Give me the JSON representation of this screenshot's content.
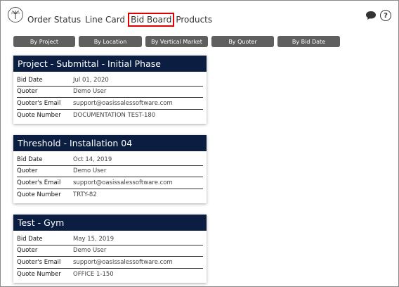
{
  "nav": {
    "items": [
      "Order Status",
      "Line Card",
      "Bid Board",
      "Products"
    ],
    "active_index": 2
  },
  "filters": [
    "By Project",
    "By Location",
    "By Vertical Market",
    "By Quoter",
    "By Bid Date"
  ],
  "cards": [
    {
      "title": "Project - Submittal - Initial Phase",
      "rows": [
        {
          "label": "Bid Date",
          "value": "Jul 01, 2020"
        },
        {
          "label": "Quoter",
          "value": "Demo User"
        },
        {
          "label": "Quoter's Email",
          "value": "support@oasissalessoftware.com"
        },
        {
          "label": "Quote Number",
          "value": "DOCUMENTATION TEST-180"
        }
      ]
    },
    {
      "title": "Threshold - Installation 04",
      "rows": [
        {
          "label": "Bid Date",
          "value": "Oct 14, 2019"
        },
        {
          "label": "Quoter",
          "value": "Demo User"
        },
        {
          "label": "Quoter's Email",
          "value": "support@oasissalessoftware.com"
        },
        {
          "label": "Quote Number",
          "value": "TRTY-82"
        }
      ]
    },
    {
      "title": "Test - Gym",
      "rows": [
        {
          "label": "Bid Date",
          "value": "May 15, 2019"
        },
        {
          "label": "Quoter",
          "value": "Demo User"
        },
        {
          "label": "Quoter's Email",
          "value": "support@oasissalessoftware.com"
        },
        {
          "label": "Quote Number",
          "value": "OFFICE 1-150"
        }
      ]
    }
  ],
  "colors": {
    "card_header": "#0b1e42",
    "filter_button": "#5f5f5f",
    "active_highlight": "#e00000"
  }
}
